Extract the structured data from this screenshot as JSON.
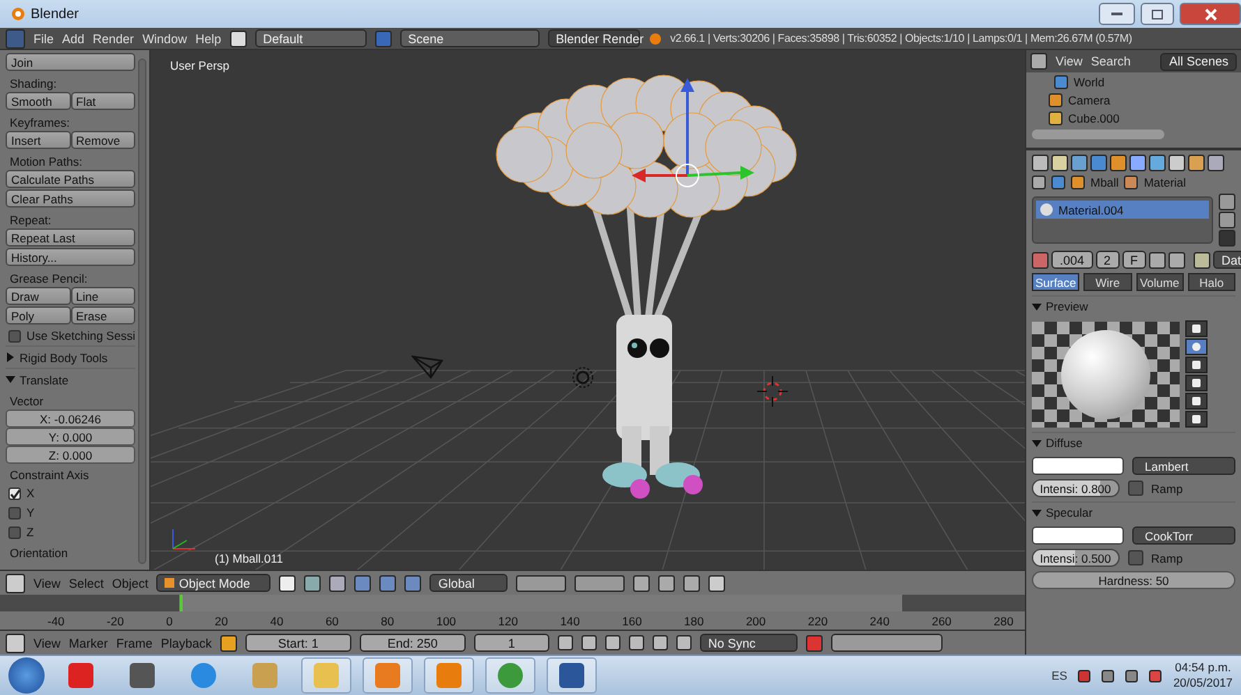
{
  "title_bar": {
    "title": "Blender"
  },
  "top_header": {
    "menus": [
      "File",
      "Add",
      "Render",
      "Window",
      "Help"
    ],
    "layout": "Default",
    "scene": "Scene",
    "engine": "Blender Render",
    "stats": "v2.66.1 | Verts:30206 | Faces:35898 | Tris:60352 | Objects:1/10 | Lamps:0/1 | Mem:26.67M (0.57M)"
  },
  "toolshelf": {
    "items": [
      {
        "kind": "buttons",
        "labels": [
          "Join"
        ]
      },
      {
        "kind": "heading",
        "label": "Shading:"
      },
      {
        "kind": "buttons",
        "labels": [
          "Smooth",
          "Flat"
        ]
      },
      {
        "kind": "heading",
        "label": "Keyframes:"
      },
      {
        "kind": "buttons",
        "labels": [
          "Insert",
          "Remove"
        ]
      },
      {
        "kind": "heading",
        "label": "Motion Paths:"
      },
      {
        "kind": "buttons",
        "labels": [
          "Calculate Paths"
        ]
      },
      {
        "kind": "buttons",
        "labels": [
          "Clear Paths"
        ]
      },
      {
        "kind": "heading",
        "label": "Repeat:"
      },
      {
        "kind": "buttons",
        "labels": [
          "Repeat Last"
        ]
      },
      {
        "kind": "buttons",
        "labels": [
          "History..."
        ]
      },
      {
        "kind": "heading",
        "label": "Grease Pencil:"
      },
      {
        "kind": "buttons",
        "labels": [
          "Draw",
          "Line"
        ]
      },
      {
        "kind": "buttons",
        "labels": [
          "Poly",
          "Erase"
        ]
      },
      {
        "kind": "checkbox",
        "label": "Use Sketching Sessi",
        "checked": false
      },
      {
        "kind": "panel",
        "label": "Rigid Body Tools",
        "expanded": false
      },
      {
        "kind": "panel",
        "label": "Translate",
        "expanded": true
      },
      {
        "kind": "heading",
        "label": "Vector"
      },
      {
        "kind": "number",
        "label": "X: -0.06246"
      },
      {
        "kind": "number",
        "label": "Y: 0.000"
      },
      {
        "kind": "number",
        "label": "Z: 0.000"
      },
      {
        "kind": "heading",
        "label": "Constraint Axis"
      },
      {
        "kind": "checkbox",
        "label": "X",
        "checked": true
      },
      {
        "kind": "checkbox",
        "label": "Y",
        "checked": false
      },
      {
        "kind": "checkbox",
        "label": "Z",
        "checked": false
      },
      {
        "kind": "heading",
        "label": "Orientation"
      }
    ]
  },
  "viewport": {
    "view_label": "User Persp",
    "object_label": "(1) Mball.011"
  },
  "viewport_header": {
    "menus": [
      "View",
      "Select",
      "Object"
    ],
    "mode": "Object Mode",
    "orientation": "Global"
  },
  "timeline": {
    "ticks": [
      "-40",
      "-20",
      "0",
      "20",
      "40",
      "60",
      "80",
      "100",
      "120",
      "140",
      "160",
      "180",
      "200",
      "220",
      "240",
      "260",
      "280"
    ]
  },
  "timeline_header": {
    "menus": [
      "View",
      "Marker",
      "Frame",
      "Playback"
    ],
    "start": "Start: 1",
    "end": "End: 250",
    "frame": "1",
    "sync": "No Sync"
  },
  "outliner": {
    "menus": [
      "View",
      "Search"
    ],
    "filter": "All Scenes",
    "items": [
      {
        "label": "World"
      },
      {
        "label": "Camera"
      },
      {
        "label": "Cube.000"
      }
    ]
  },
  "properties": {
    "breadcrumb": [
      "Mball",
      "Material"
    ],
    "materials": [
      {
        "name": "Material.004",
        "selected": true
      }
    ],
    "datablock": ".004",
    "users": "2",
    "fake": "F",
    "data_menu": "Dat",
    "tabs": [
      {
        "label": "Surface",
        "selected": true
      },
      {
        "label": "Wire",
        "selected": false
      },
      {
        "label": "Volume",
        "selected": false
      },
      {
        "label": "Halo",
        "selected": false
      }
    ],
    "preview": {
      "label": "Preview",
      "shapes": [
        {
          "selected": false
        },
        {
          "selected": true
        },
        {
          "selected": false
        },
        {
          "selected": false
        },
        {
          "selected": false
        },
        {
          "selected": false
        }
      ]
    },
    "diffuse": {
      "label": "Diffuse",
      "shader": "Lambert",
      "intensity": "Intensi: 0.800",
      "level": 0.8,
      "ramp_label": "Ramp",
      "ramp": false
    },
    "specular": {
      "label": "Specular",
      "shader": "CookTorr",
      "intensity": "Intensi: 0.500",
      "level": 0.5,
      "ramp_label": "Ramp",
      "ramp": false,
      "hardness": "Hardness: 50"
    }
  },
  "taskbar": {
    "language": "ES",
    "time": "04:54 p.m.",
    "date": "20/05/2017"
  }
}
